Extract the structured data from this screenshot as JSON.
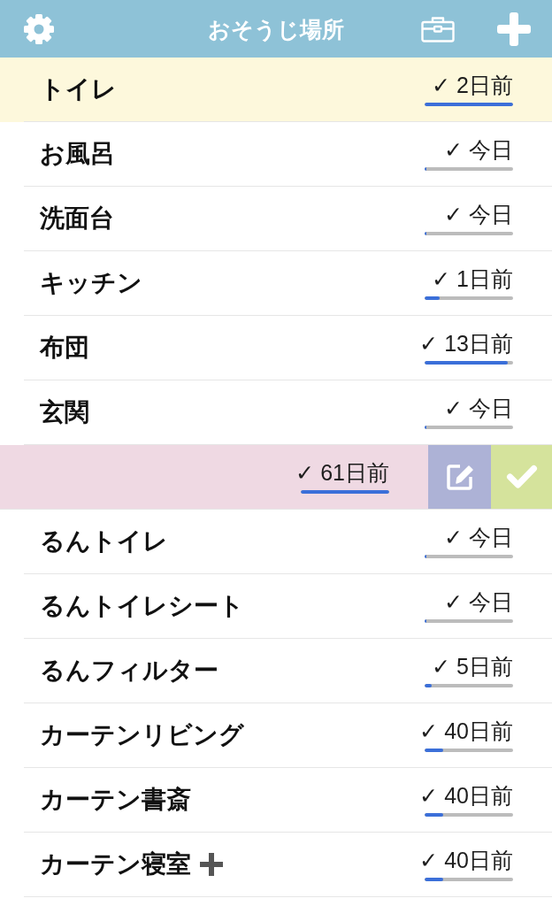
{
  "header": {
    "title": "おそうじ場所"
  },
  "places": [
    {
      "name": "トイレ",
      "last_cleaned": "✓ 2日前",
      "level": 1,
      "selected": true,
      "swiped": false,
      "plus_mark": false
    },
    {
      "name": "お風呂",
      "last_cleaned": "✓ 今日",
      "level": 0,
      "selected": false,
      "swiped": false,
      "plus_mark": false
    },
    {
      "name": "洗面台",
      "last_cleaned": "✓ 今日",
      "level": 0,
      "selected": false,
      "swiped": false,
      "plus_mark": false
    },
    {
      "name": "キッチン",
      "last_cleaned": "✓ 1日前",
      "level": 0.17,
      "selected": false,
      "swiped": false,
      "plus_mark": false
    },
    {
      "name": "布団",
      "last_cleaned": "✓ 13日前",
      "level": 0.94,
      "selected": false,
      "swiped": false,
      "plus_mark": false
    },
    {
      "name": "玄関",
      "last_cleaned": "✓ 今日",
      "level": 0,
      "selected": false,
      "swiped": false,
      "plus_mark": false
    },
    {
      "last_cleaned": "✓ 61日前",
      "level": 1,
      "selected": false,
      "swiped": true,
      "plus_mark": false
    },
    {
      "name": "るんトイレ",
      "last_cleaned": "✓ 今日",
      "level": 0,
      "selected": false,
      "swiped": false,
      "plus_mark": false
    },
    {
      "name": "るんトイレシート",
      "last_cleaned": "✓ 今日",
      "level": 0,
      "selected": false,
      "swiped": false,
      "plus_mark": false
    },
    {
      "name": "るんフィルター",
      "last_cleaned": "✓ 5日前",
      "level": 0.08,
      "selected": false,
      "swiped": false,
      "plus_mark": false
    },
    {
      "name": "カーテンリビング",
      "last_cleaned": "✓ 40日前",
      "level": 0.21,
      "selected": false,
      "swiped": false,
      "plus_mark": false
    },
    {
      "name": "カーテン書斎",
      "last_cleaned": "✓ 40日前",
      "level": 0.21,
      "selected": false,
      "swiped": false,
      "plus_mark": false
    },
    {
      "name": "カーテン寝室",
      "last_cleaned": "✓ 40日前",
      "level": 0.21,
      "selected": false,
      "swiped": false,
      "plus_mark": true
    }
  ]
}
